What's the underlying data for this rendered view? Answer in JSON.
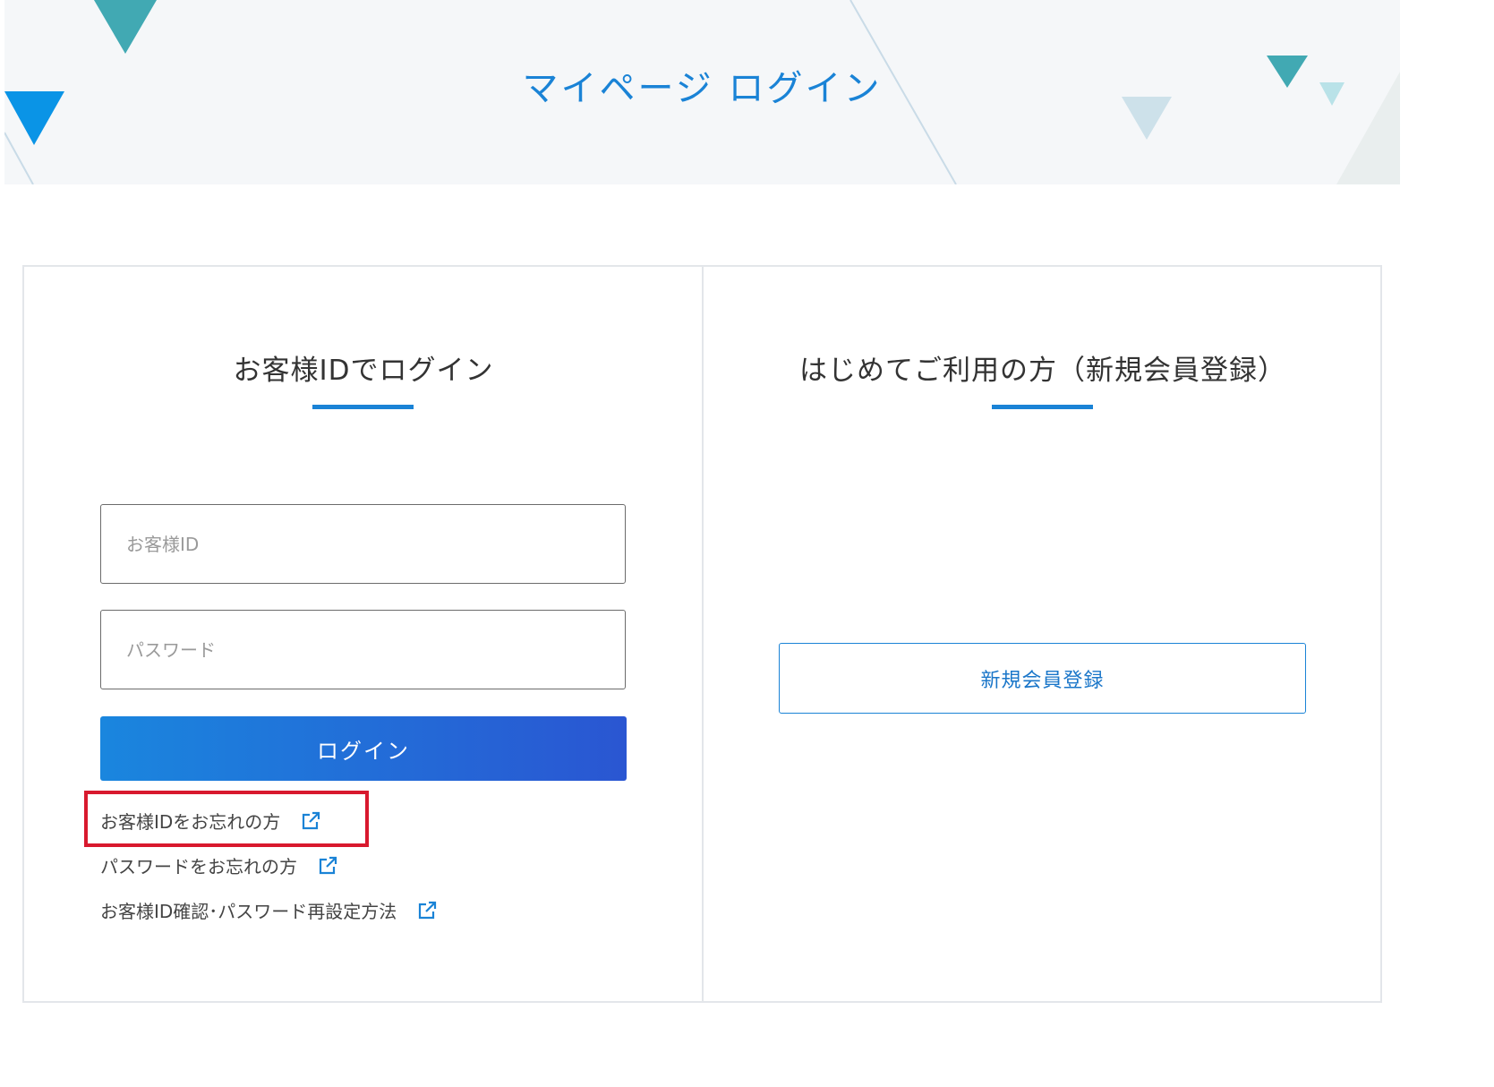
{
  "header": {
    "title": "マイページ ログイン"
  },
  "login": {
    "title": "お客様IDでログイン",
    "id_placeholder": "お客様ID",
    "id_value": "",
    "password_placeholder": "パスワード",
    "password_value": "",
    "login_button": "ログイン",
    "links": [
      {
        "label": "お客様IDをお忘れの方",
        "icon": "external-link-icon"
      },
      {
        "label": "パスワードをお忘れの方",
        "icon": "external-link-icon"
      },
      {
        "label": "お客様ID確認･パスワード再設定方法",
        "icon": "external-link-icon"
      }
    ]
  },
  "register": {
    "title": "はじめてご利用の方（新規会員登録）",
    "button": "新規会員登録"
  },
  "colors": {
    "accent": "#1a83d6",
    "button_gradient_start": "#1a86de",
    "button_gradient_end": "#2a56d2",
    "highlight": "#d8192e",
    "hero_background": "#f5f7f9"
  }
}
